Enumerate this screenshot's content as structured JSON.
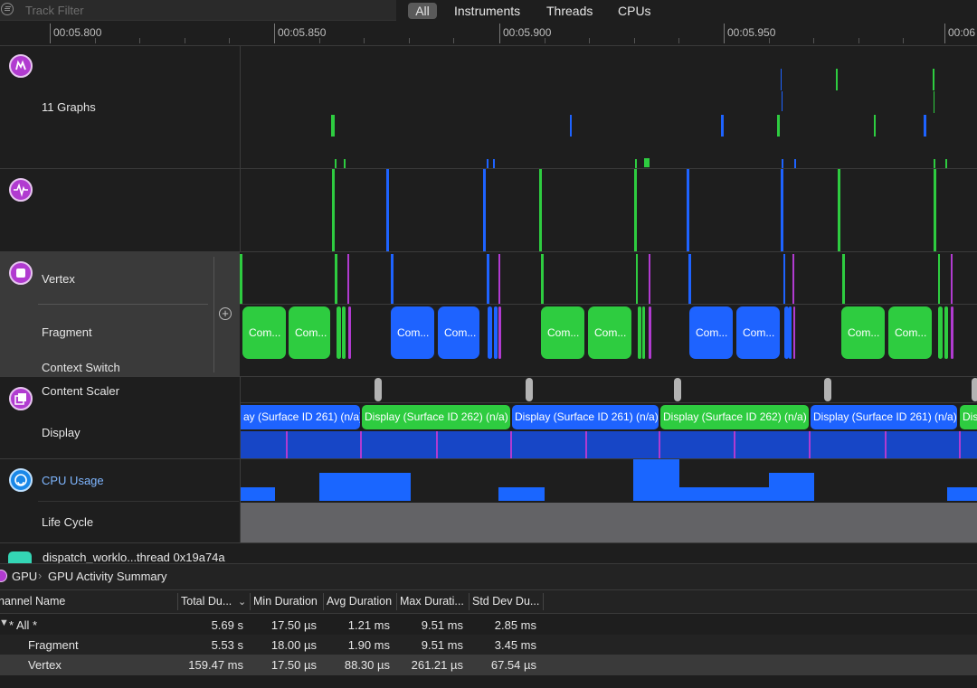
{
  "filter": {
    "placeholder": "Track Filter"
  },
  "scope": {
    "all": "All",
    "instruments": "Instruments",
    "threads": "Threads",
    "cpus": "CPUs"
  },
  "ruler": {
    "labels": [
      "00:05.800",
      "00:05.850",
      "00:05.900",
      "00:05.950",
      "00:06"
    ]
  },
  "tracks": {
    "graphs_label": "11 Graphs",
    "vertex_label": "Vertex",
    "fragment_label": "Fragment",
    "context_switch_label": "Context Switch",
    "content_scaler_label": "Content Scaler",
    "display_label": "Display",
    "cpu_usage_label": "CPU Usage",
    "life_cycle_label": "Life Cycle",
    "thread_label": "dispatch_worklo...thread 0x19a74a"
  },
  "fragment_pills": [
    "Com...",
    "Com...",
    "Com...",
    "Com...",
    "Com...",
    "Com...",
    "Com...",
    "Com...",
    "Com...",
    "Com..."
  ],
  "display_blocks": [
    "ay (Surface ID 261) (n/a)",
    "Display (Surface ID 262) (n/a)",
    "Display (Surface ID 261) (n/a)",
    "Display (Surface ID 262) (n/a)",
    "Display (Surface ID 261) (n/a)",
    "Dis"
  ],
  "breadcrumb": {
    "gpu": "GPU",
    "summary": "GPU Activity Summary"
  },
  "table": {
    "headers": [
      "hannel Name",
      "Total Du...",
      "Min Duration",
      "Avg Duration",
      "Max Durati...",
      "Std Dev Du..."
    ],
    "rows": [
      {
        "name": "* All *",
        "total": "5.69 s",
        "min": "17.50 µs",
        "avg": "1.21 ms",
        "max": "9.51 ms",
        "std": "2.85 ms"
      },
      {
        "name": "Fragment",
        "total": "5.53 s",
        "min": "18.00 µs",
        "avg": "1.90 ms",
        "max": "9.51 ms",
        "std": "3.45 ms"
      },
      {
        "name": "Vertex",
        "total": "159.47 ms",
        "min": "17.50 µs",
        "avg": "88.30 µs",
        "max": "261.21 µs",
        "std": "67.54 µs"
      }
    ]
  },
  "colors": {
    "green": "#2ecc40",
    "blue": "#1e63ff",
    "purple": "#b13bd0",
    "cpu_blue": "#1a66ff"
  }
}
